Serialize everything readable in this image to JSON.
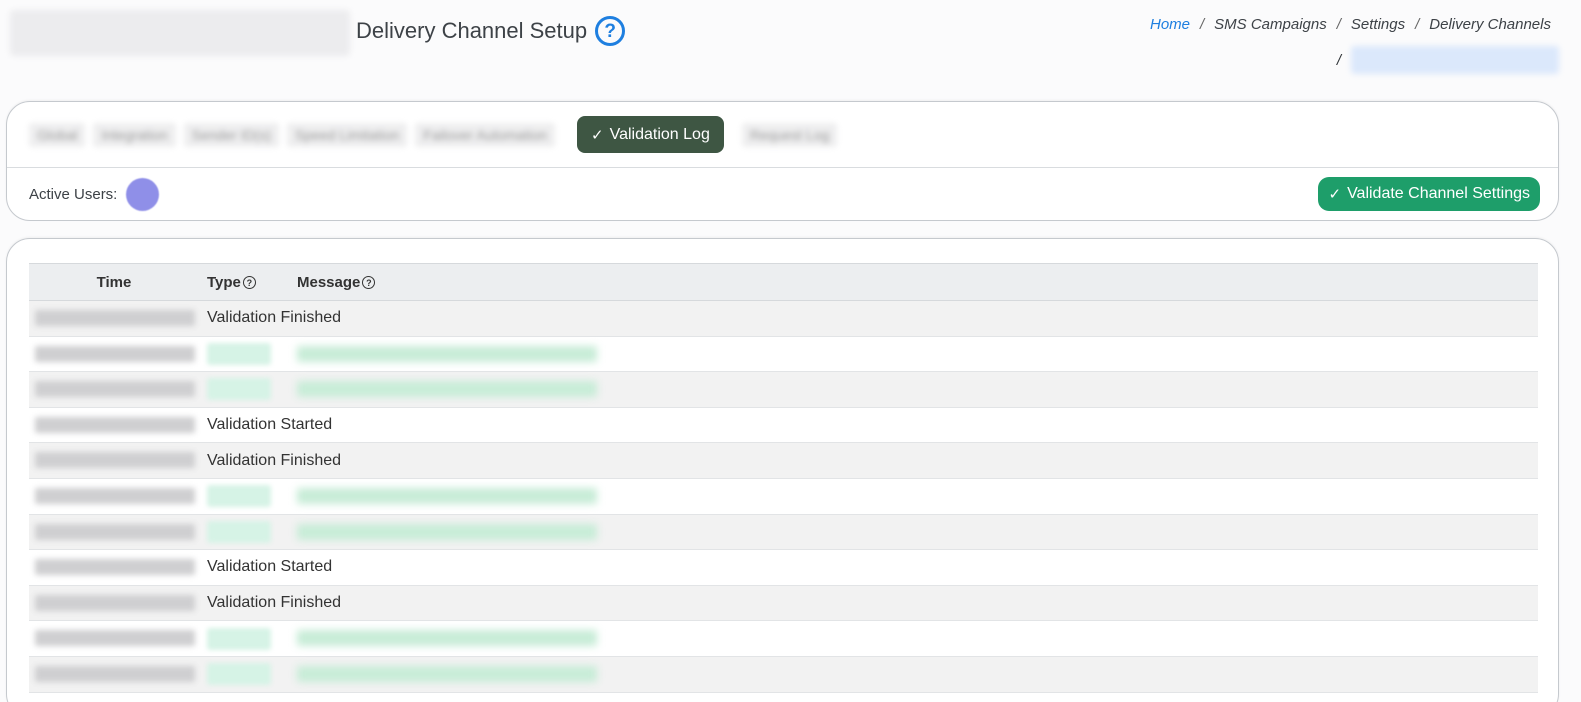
{
  "header": {
    "page_title": "Delivery Channel Setup",
    "help_icon": "question-circle-icon"
  },
  "breadcrumb": {
    "home": "Home",
    "sep": "/",
    "items": [
      "SMS Campaigns",
      "Settings",
      "Delivery Channels"
    ]
  },
  "tabs": {
    "blurred": [
      "Global",
      "Integration",
      "Sender ID(s)",
      "Speed Limitation",
      "Failover Automation"
    ],
    "active": "Validation Log",
    "after": [
      "Request Log"
    ]
  },
  "users": {
    "label": "Active Users:"
  },
  "actions": {
    "validate": "Validate Channel Settings"
  },
  "log_table": {
    "headers": {
      "time": "Time",
      "type": "Type",
      "message": "Message"
    },
    "help_glyph": "?",
    "rows": [
      {
        "status": "Validation Finished"
      },
      {
        "status": ""
      },
      {
        "status": ""
      },
      {
        "status": "Validation Started"
      },
      {
        "status": "Validation Finished"
      },
      {
        "status": ""
      },
      {
        "status": ""
      },
      {
        "status": "Validation Started"
      },
      {
        "status": "Validation Finished"
      },
      {
        "status": ""
      },
      {
        "status": ""
      }
    ]
  },
  "colors": {
    "accent": "#1e7fe0",
    "tab_active": "#3e5643",
    "success": "#1e9e6a"
  }
}
